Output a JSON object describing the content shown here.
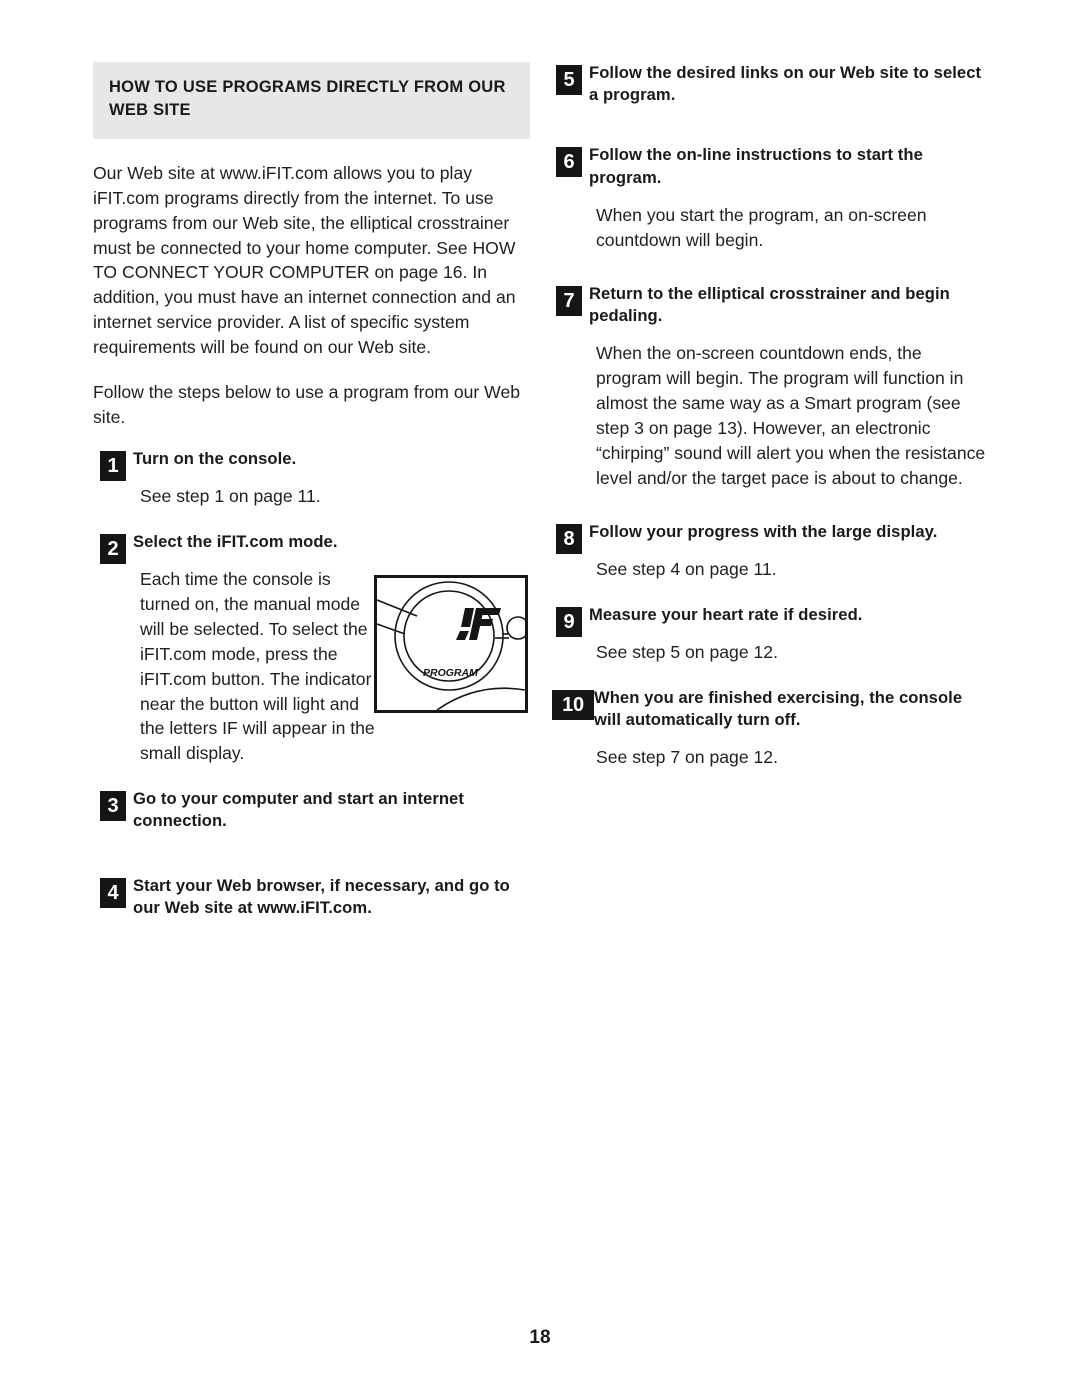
{
  "page": {
    "number": "18"
  },
  "left_column": {
    "section_title": "HOW TO USE PROGRAMS DIRECTLY FROM OUR WEB SITE",
    "intro_paragraph": "Our Web site at www.iFIT.com allows you to play iFIT.com programs directly from the internet. To use programs from our Web site, the elliptical crosstrainer must be connected to your home computer. See HOW TO CONNECT YOUR COMPUTER on page 16. In addition, you must have an internet connection and an internet service provider. A list of specific system requirements will be found on our Web site.",
    "lead_in": "Follow the steps below to use a program from our Web site.",
    "steps": [
      {
        "number": "1",
        "title": "Turn on the console.",
        "body": "See step 1 on page 11."
      },
      {
        "number": "2",
        "title": "Select the iFIT.com mode.",
        "body": "Each time the console is turned on, the manual mode will be selected. To select the iFIT.com mode, press the iFIT.com button. The indicator near the button will light and the letters IF will appear in the small display."
      },
      {
        "number": "3",
        "title": "Go to your computer and start an internet connection.",
        "body": ""
      },
      {
        "number": "4",
        "title": "Start your Web browser, if necessary, and go to our Web site at www.iFIT.com.",
        "body": ""
      }
    ],
    "figure": {
      "display_value": "IF",
      "display_label": "PROGRAM"
    }
  },
  "right_column": {
    "steps": [
      {
        "number": "5",
        "title": "Follow the desired links on our Web site to select a program.",
        "body": ""
      },
      {
        "number": "6",
        "title": "Follow the on-line instructions to start the program.",
        "body": "When you start the program, an on-screen countdown will begin."
      },
      {
        "number": "7",
        "title": "Return to the elliptical crosstrainer and begin pedaling.",
        "body": "When the on-screen countdown ends, the program will begin. The program will function in almost the same way as a Smart program (see step 3 on page 13). However, an electronic “chirping” sound will alert you when the resistance level and/or the target pace is about to change."
      },
      {
        "number": "8",
        "title": "Follow your progress with the large display.",
        "body": "See step 4 on page 11."
      },
      {
        "number": "9",
        "title": "Measure your heart rate if desired.",
        "body": "See step 5 on page 12."
      },
      {
        "number": "10",
        "title": "When you are finished exercising, the console will automatically turn off.",
        "body": "See step 7 on page 12."
      }
    ]
  }
}
